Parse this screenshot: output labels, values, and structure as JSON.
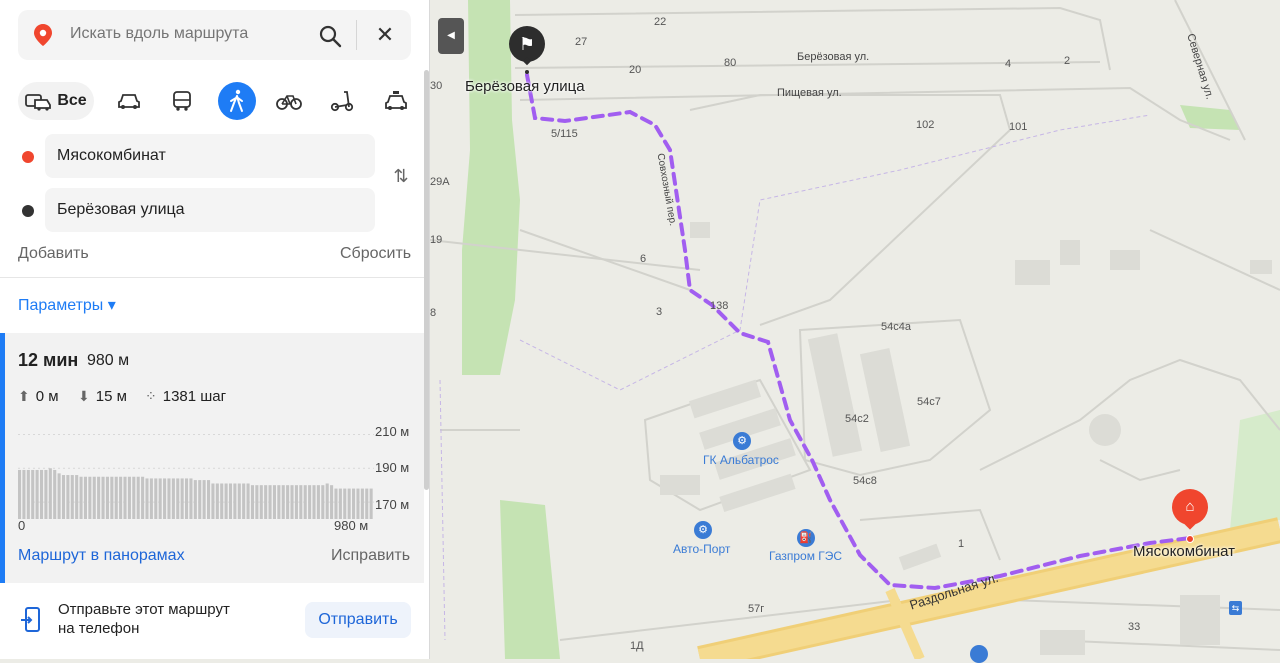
{
  "search": {
    "placeholder": "Искать вдоль маршрута"
  },
  "modes": {
    "all_label": "Все",
    "items": [
      "car-icon",
      "bus-icon",
      "pedestrian-icon",
      "bicycle-icon",
      "scooter-icon",
      "taxi-icon"
    ],
    "active": "pedestrian-icon"
  },
  "points": [
    {
      "label": "Мясокомбинат",
      "dot_color": "#f0462e"
    },
    {
      "label": "Берёзовая улица",
      "dot_color": "#333333"
    }
  ],
  "actions": {
    "add": "Добавить",
    "reset": "Сбросить",
    "params": "Параметры ▾"
  },
  "route": {
    "time": "12 мин",
    "distance": "980 м",
    "ascent": "0 м",
    "descent": "15 м",
    "steps": "1381 шаг",
    "panorama_link": "Маршрут в панорамах",
    "fix_link": "Исправить"
  },
  "chart_data": {
    "type": "bar",
    "ylabels": [
      "210 м",
      "190 м",
      "170 м"
    ],
    "xlabels": [
      "0",
      "980 м"
    ],
    "ylim": [
      160,
      215
    ],
    "values": [
      189,
      189,
      189,
      189,
      189,
      189,
      189,
      190,
      189,
      187,
      186,
      186,
      186,
      186,
      185,
      185,
      185,
      185,
      185,
      185,
      185,
      185,
      185,
      185,
      185,
      185,
      185,
      185,
      185,
      184,
      184,
      184,
      184,
      184,
      184,
      184,
      184,
      184,
      184,
      184,
      183,
      183,
      183,
      183,
      181,
      181,
      181,
      181,
      181,
      181,
      181,
      181,
      181,
      180,
      180,
      180,
      180,
      180,
      180,
      180,
      180,
      180,
      180,
      180,
      180,
      180,
      180,
      180,
      180,
      180,
      181,
      180,
      178,
      178,
      178,
      178,
      178,
      178,
      178,
      178,
      178
    ]
  },
  "send": {
    "text_line1": "Отправьте этот маршрут",
    "text_line2": "на телефон",
    "button": "Отправить"
  },
  "map": {
    "start_label": "Берёзовая улица",
    "end_label": "Мясокомбинат",
    "streets": [
      "Берёзовая ул.",
      "Пищевая ул.",
      "Северная ул.",
      "Раздольная ул.",
      "Совхозный пер."
    ],
    "pois": [
      "ГК Альбатрос",
      "Авто-Порт",
      "Газпром ГЭС"
    ],
    "house_numbers": [
      "22",
      "27",
      "20",
      "80",
      "4",
      "2",
      "102",
      "101",
      "5/115",
      "29А",
      "19",
      "6",
      "3",
      "8",
      "138",
      "54с4а",
      "54с7",
      "54с2",
      "54с8",
      "1",
      "57г",
      "33",
      "1Д",
      "30"
    ],
    "route_color": "#a15ef0"
  }
}
